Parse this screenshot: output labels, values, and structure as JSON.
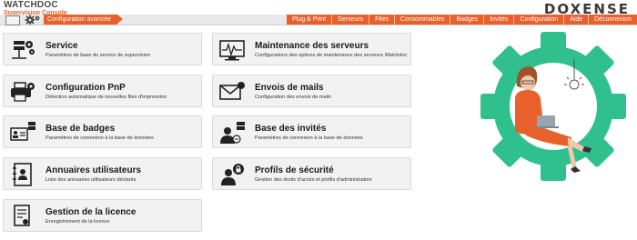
{
  "header": {
    "brand": "WATCHDOC",
    "subtitle": "Supervision Console",
    "doxense": "DOXENSE",
    "breadcrumb": "Configuration avancée"
  },
  "menu": [
    {
      "label": "Plug & Print"
    },
    {
      "label": "Serveurs"
    },
    {
      "label": "Files"
    },
    {
      "label": "Consommables"
    },
    {
      "label": "Badges"
    },
    {
      "label": "Invités"
    },
    {
      "label": "Configuration"
    },
    {
      "label": "Aide"
    },
    {
      "label": "Déconnexion"
    }
  ],
  "cards": [
    {
      "title": "Service",
      "desc": "Paramètres de base du service de supervision",
      "icon": "server-gear-icon"
    },
    {
      "title": "Maintenance des serveurs",
      "desc": "Configurations des options de maintenance des serveurs Watchdoc",
      "icon": "monitor-pulse-icon"
    },
    {
      "title": "Configuration PnP",
      "desc": "Détection automatique de nouvelles files d'impression",
      "icon": "printer-gear-icon"
    },
    {
      "title": "Envois de mails",
      "desc": "Configuration des envois de mails",
      "icon": "mail-icon"
    },
    {
      "title": "Base de badges",
      "desc": "Paramètres de connexion à la base de données",
      "icon": "badge-database-icon"
    },
    {
      "title": "Base des invités",
      "desc": "Paramètres de connexion à la base de données",
      "icon": "guest-database-icon"
    },
    {
      "title": "Annuaires utilisateurs",
      "desc": "Liste des annuaires utilisateurs déclarés",
      "icon": "address-book-icon"
    },
    {
      "title": "Profils de sécurité",
      "desc": "Gestion des droits d'accès et profils d'administration",
      "icon": "security-profile-icon"
    },
    {
      "title": "Gestion de la licence",
      "desc": "Enregistrement de la licence",
      "icon": "license-certificate-icon"
    }
  ],
  "colors": {
    "accent": "#e8612c",
    "illustration_green": "#2fc08e"
  }
}
